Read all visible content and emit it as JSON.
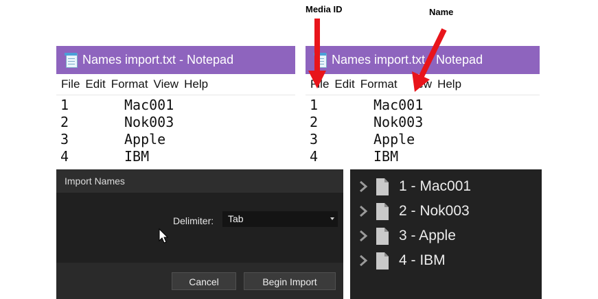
{
  "annotations": {
    "media_id": "Media ID",
    "name": "Name"
  },
  "notepad": {
    "title": "Names import.txt - Notepad",
    "menu": [
      "File",
      "Edit",
      "Format",
      "View",
      "Help"
    ],
    "rows": [
      {
        "id": "1",
        "name": "Mac001"
      },
      {
        "id": "2",
        "name": "Nok003"
      },
      {
        "id": "3",
        "name": "Apple"
      },
      {
        "id": "4",
        "name": "IBM"
      }
    ]
  },
  "notepad_right": {
    "title": "Names import.txt - Notepad",
    "menu": [
      "File",
      "Edit",
      "Format",
      "iew",
      "Help"
    ]
  },
  "dialog": {
    "title": "Import Names",
    "delimiter_label": "Delimiter:",
    "delimiter_value": "Tab",
    "cancel": "Cancel",
    "begin_import": "Begin Import"
  },
  "tree": {
    "items": [
      "1 - Mac001",
      "2 - Nok003",
      "3 - Apple",
      "4 - IBM"
    ]
  },
  "colors": {
    "titlebar": "#8e64be",
    "arrow": "#e8151b",
    "dark": "#202020"
  }
}
